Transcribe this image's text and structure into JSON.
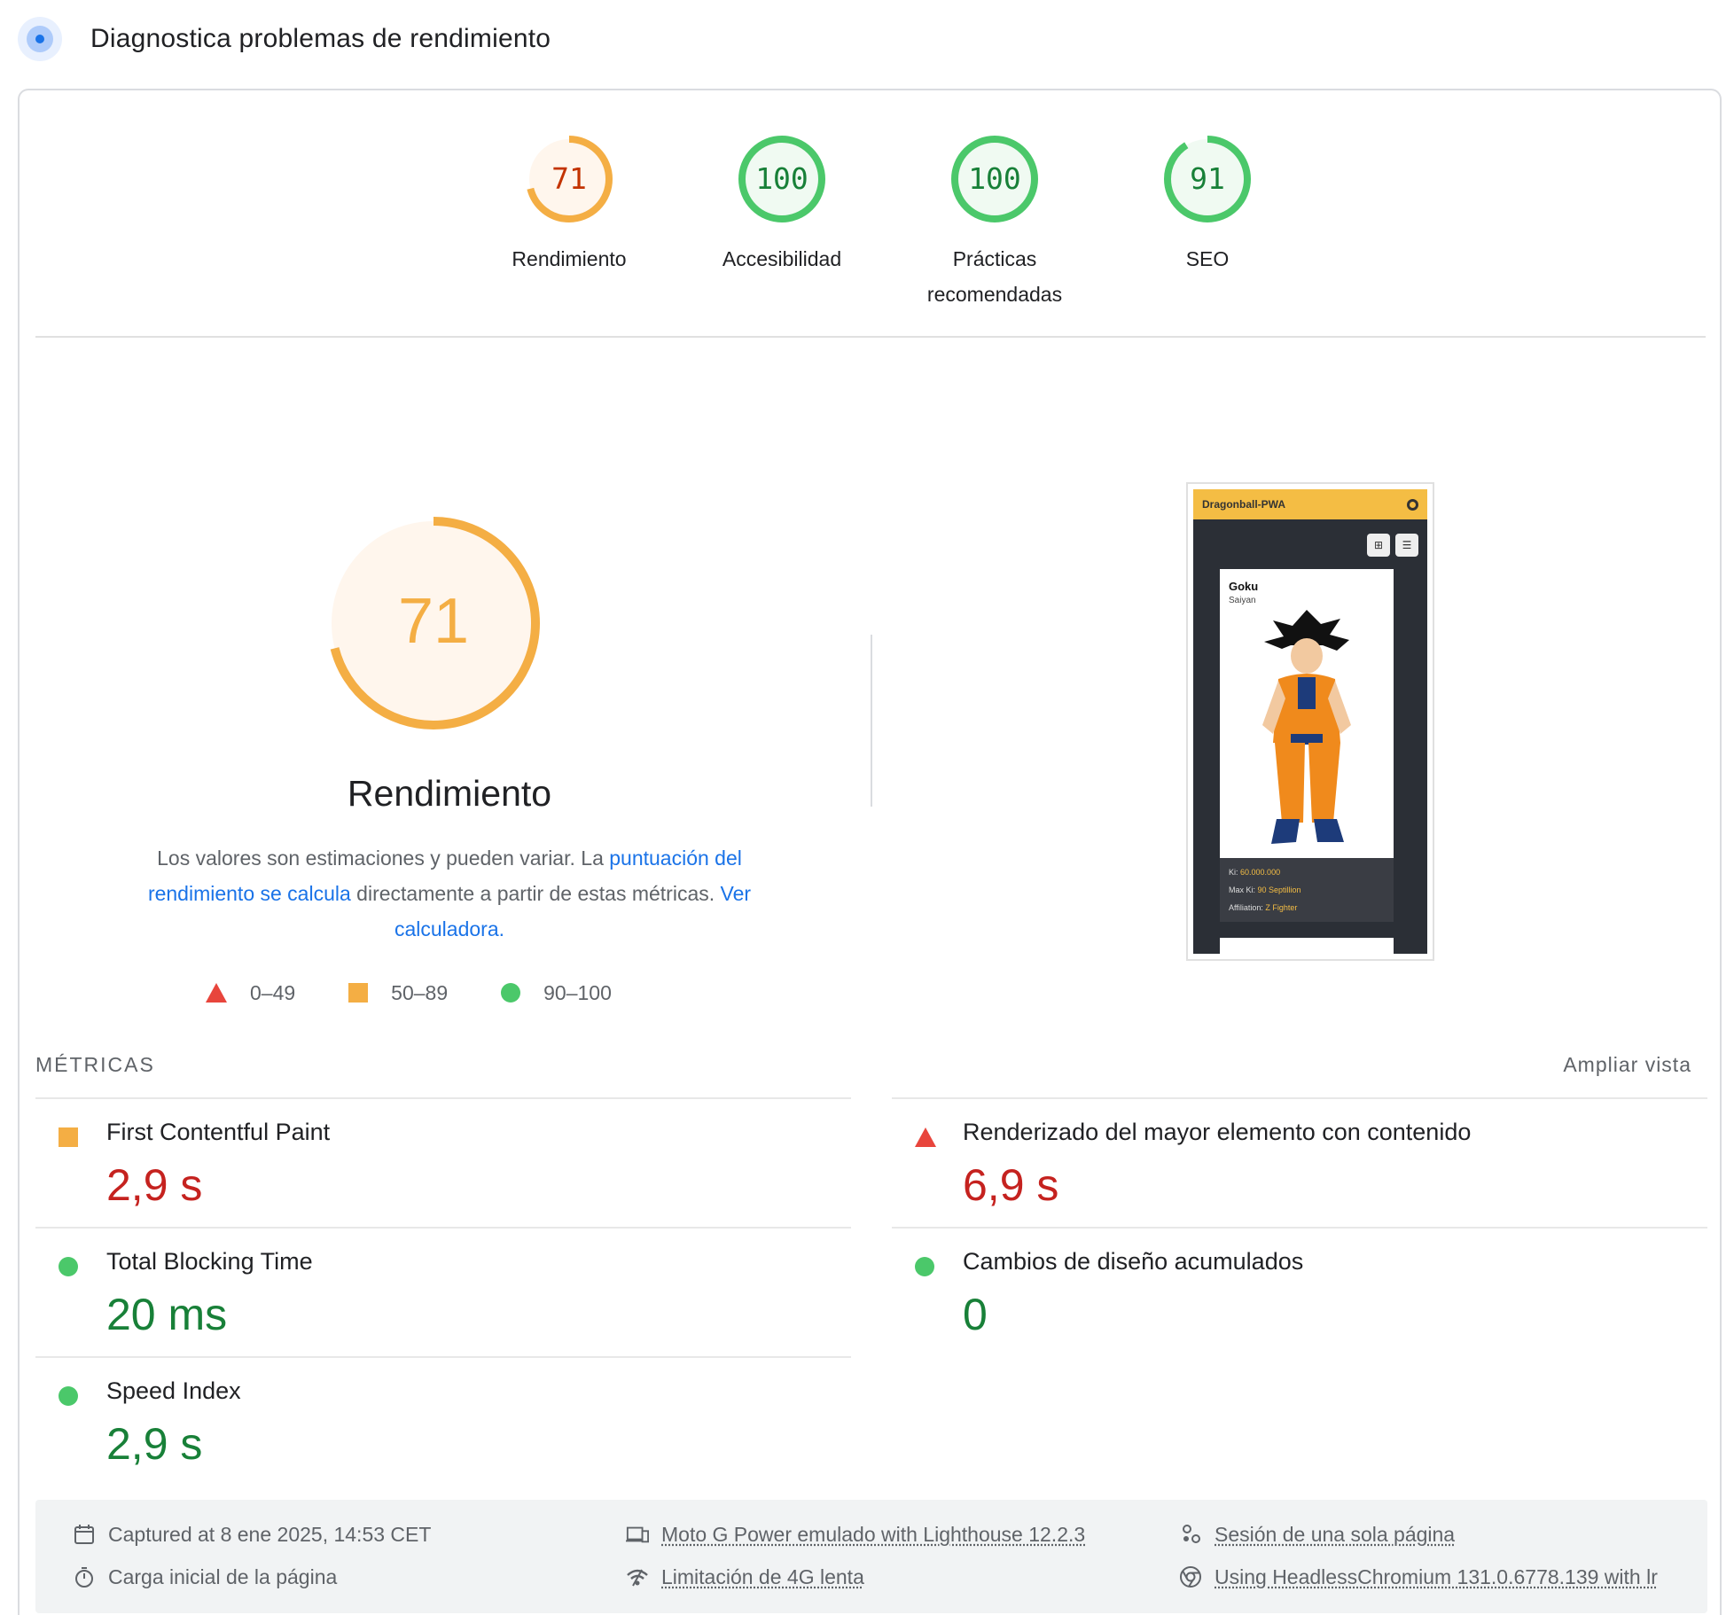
{
  "header": {
    "title": "Diagnostica problemas de rendimiento",
    "icon": "lighthouse-icon"
  },
  "gauges": [
    {
      "score": "71",
      "label": "Rendimiento",
      "value": 0.71,
      "status": "average"
    },
    {
      "score": "100",
      "label": "Accesibilidad",
      "value": 1.0,
      "status": "pass"
    },
    {
      "score": "100",
      "label": "Prácticas recomendadas",
      "value": 1.0,
      "status": "pass"
    },
    {
      "score": "91",
      "label": "SEO",
      "value": 0.91,
      "status": "pass"
    }
  ],
  "performance": {
    "score": "71",
    "value": 0.71,
    "title": "Rendimiento",
    "desc_1": "Los valores son estimaciones y pueden variar. La ",
    "desc_link_1": "puntuación del rendimiento se calcula",
    "desc_2": " directamente a partir de estas métricas. ",
    "desc_link_2": "Ver calculadora.",
    "legend": [
      {
        "range": "0–49",
        "shape": "triangle"
      },
      {
        "range": "50–89",
        "shape": "square"
      },
      {
        "range": "90–100",
        "shape": "circle"
      }
    ]
  },
  "screenshot": {
    "app_title": "Dragonball-PWA",
    "character_name": "Goku",
    "character_race": "Saiyan",
    "ki_label": "Ki:",
    "ki_value": "60.000.000",
    "max_ki_label": "Max Ki:",
    "max_ki_value": "90 Septillion",
    "affiliation_label": "Affiliation:",
    "affiliation_value": "Z Fighter"
  },
  "metrics": {
    "header": "MÉTRICAS",
    "expand_label": "Ampliar vista",
    "items": [
      {
        "name": "First Contentful Paint",
        "value": "2,9 s",
        "status": "average"
      },
      {
        "name": "Renderizado del mayor elemento con contenido",
        "value": "6,9 s",
        "status": "fail"
      },
      {
        "name": "Total Blocking Time",
        "value": "20 ms",
        "status": "pass"
      },
      {
        "name": "Cambios de diseño acumulados",
        "value": "0",
        "status": "pass"
      },
      {
        "name": "Speed Index",
        "value": "2,9 s",
        "status": "pass"
      }
    ]
  },
  "footer": {
    "captured": "Captured at 8 ene 2025, 14:53 CET",
    "load": "Carga inicial de la página",
    "device": "Moto G Power emulado with Lighthouse 12.2.3",
    "throttling": "Limitación de 4G lenta",
    "session": "Sesión de una sola página",
    "browser": "Using HeadlessChromium 131.0.6778.139 with lr"
  },
  "colors": {
    "average": "#f4ae44",
    "average_text": "#c33300",
    "average_bg": "#fff6ed",
    "pass": "#4bc86a",
    "pass_text": "#188038",
    "pass_bg": "#f0faf2",
    "fail": "#e8453c",
    "link": "#1a73e8"
  }
}
